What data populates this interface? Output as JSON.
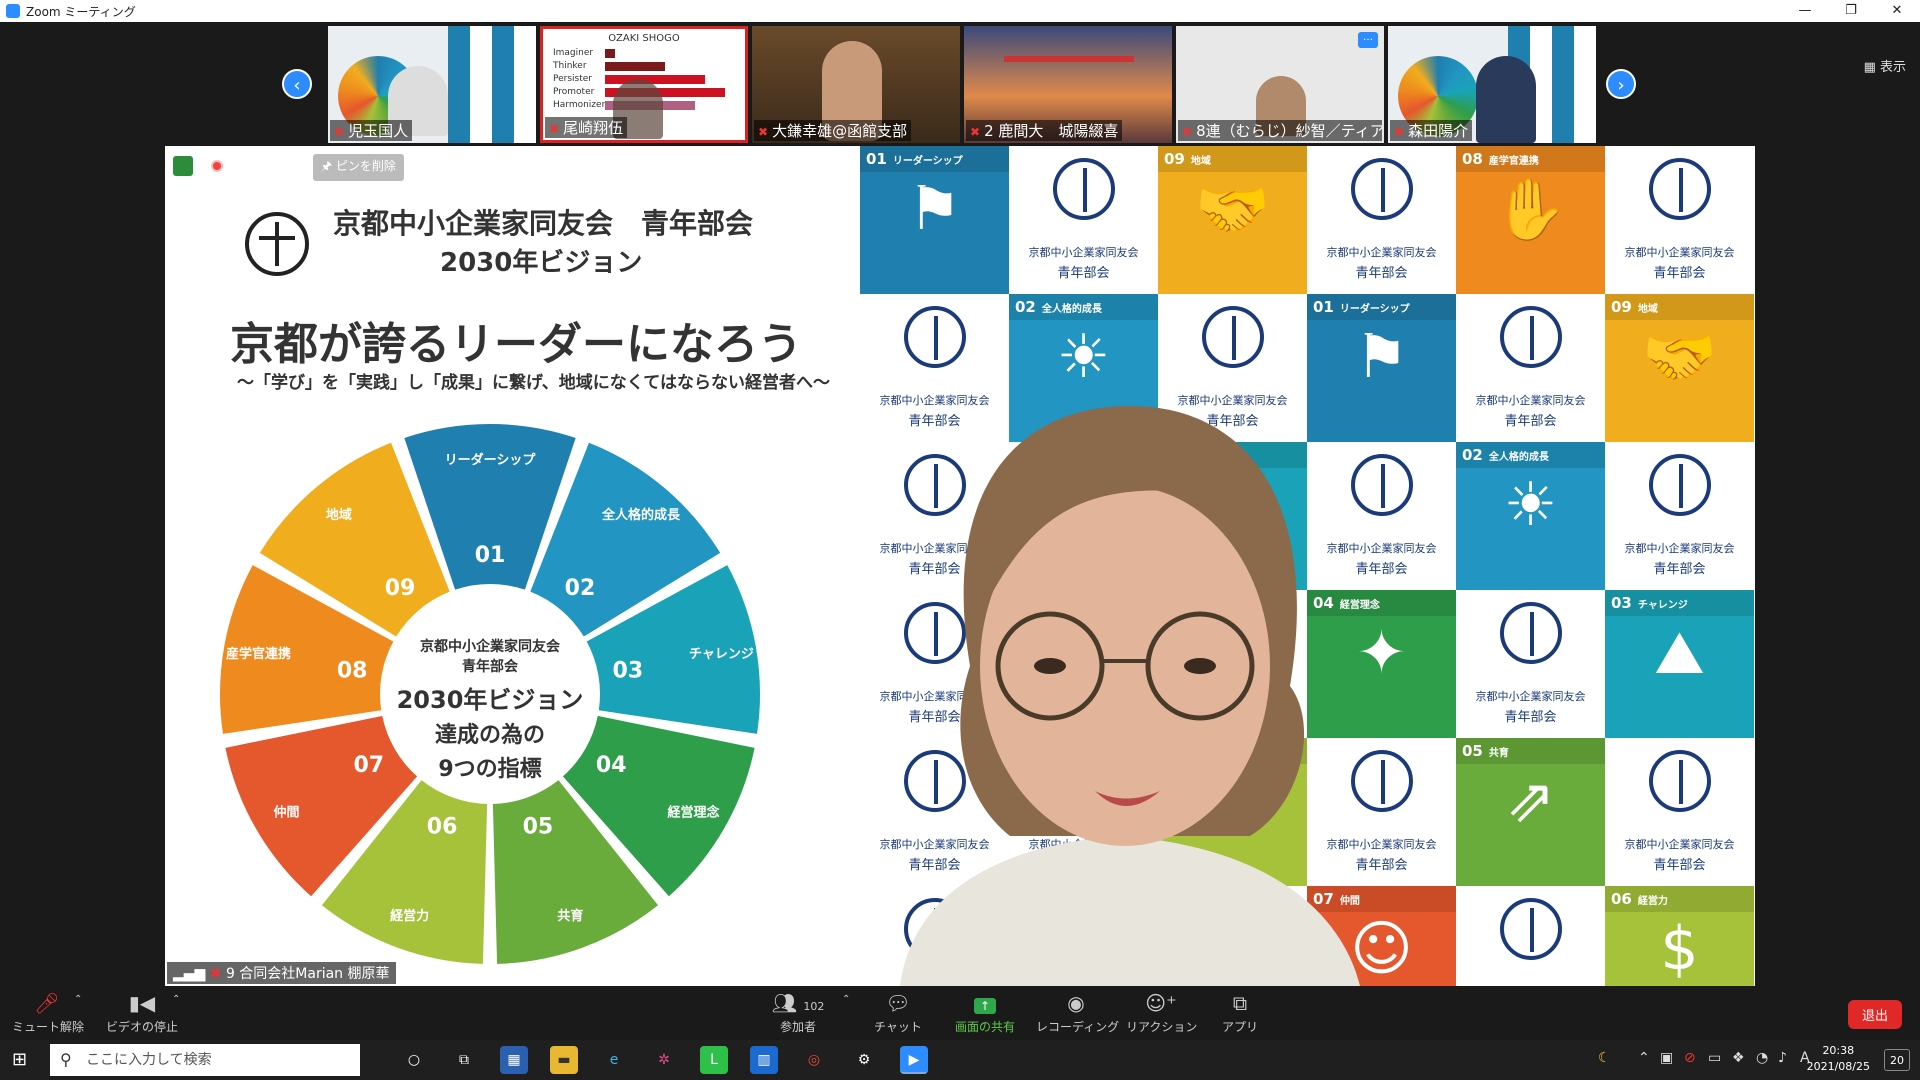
{
  "window": {
    "title": "Zoom ミーティング",
    "controls": [
      "—",
      "❐",
      "✕"
    ]
  },
  "gallery": {
    "prev_icon": "chevron-left-icon",
    "next_icon": "chevron-right-icon",
    "view_label": "▦ 表示",
    "participants": [
      {
        "name": "児玉国人",
        "muted": true
      },
      {
        "name": "尾崎翔伍",
        "muted": true,
        "overlay_title": "OZAKI SHOGO",
        "overlay_bars": [
          "Imaginer",
          "Thinker",
          "Persister",
          "Promoter",
          "Harmonizer"
        ]
      },
      {
        "name": "大鎌幸雄@函館支部",
        "muted": true
      },
      {
        "name": "2 鹿間大　城陽綴喜",
        "muted": true
      },
      {
        "name": "8連（むらじ）紗智／ティア…",
        "muted": true
      },
      {
        "name": "森田陽介",
        "muted": true
      }
    ]
  },
  "share": {
    "pin_label": "🖈 ピンを削除",
    "org_name": "京都中小企業家同友会　青年部会",
    "vision_title": "2030年ビジョン",
    "slogan": "京都が誇るリーダーになろう",
    "sub_slogan": "〜「学び」を「実践」し「成果」に繋げ、地域になくてはならない経営者へ〜",
    "wheel_center": {
      "line1": "京都中小企業家同友会",
      "line1b": "青年部会",
      "line2": "2030年ビジョン",
      "line3": "達成の為の",
      "line4": "9つの指標"
    },
    "wheel_segments": [
      {
        "num": "01",
        "label": "リーダーシップ",
        "color": "#1f7fae"
      },
      {
        "num": "02",
        "label": "全人格的成長",
        "color": "#2295c2"
      },
      {
        "num": "03",
        "label": "チャレンジ",
        "color": "#1aa3b8"
      },
      {
        "num": "04",
        "label": "経営理念",
        "color": "#2e9e4a"
      },
      {
        "num": "05",
        "label": "共育",
        "color": "#6aac3c"
      },
      {
        "num": "06",
        "label": "経営力",
        "color": "#a5c23a"
      },
      {
        "num": "07",
        "label": "仲間",
        "color": "#e5572c"
      },
      {
        "num": "08",
        "label": "産学官連携",
        "color": "#ee8a1e"
      },
      {
        "num": "09",
        "label": "地域",
        "color": "#f0ad1e"
      }
    ],
    "logo_text1": "京都中小企業家同友会",
    "logo_text2": "青年部会",
    "presenter_label": "9 合同会社Marian 棚原華"
  },
  "grid": [
    {
      "type": "tile",
      "num": "01",
      "label": "リーダーシップ",
      "color": "#1f7fae",
      "glyph": "⚑"
    },
    {
      "type": "logo"
    },
    {
      "type": "tile",
      "num": "09",
      "label": "地域",
      "color": "#f0ad1e",
      "glyph": "🤝"
    },
    {
      "type": "logo"
    },
    {
      "type": "tile",
      "num": "08",
      "label": "産学官連携",
      "color": "#ee8a1e",
      "glyph": "✋"
    },
    {
      "type": "logo"
    },
    {
      "type": "logo"
    },
    {
      "type": "tile",
      "num": "02",
      "label": "全人格的成長",
      "color": "#2295c2",
      "glyph": "☀"
    },
    {
      "type": "logo"
    },
    {
      "type": "tile",
      "num": "01",
      "label": "リーダーシップ",
      "color": "#1f7fae",
      "glyph": "⚑"
    },
    {
      "type": "logo"
    },
    {
      "type": "tile",
      "num": "09",
      "label": "地域",
      "color": "#f0ad1e",
      "glyph": "🤝"
    },
    {
      "type": "logo"
    },
    {
      "type": "logo"
    },
    {
      "type": "tile",
      "num": "03",
      "label": "チャレンジ",
      "color": "#1aa3b8",
      "glyph": "⛰"
    },
    {
      "type": "logo"
    },
    {
      "type": "tile",
      "num": "02",
      "label": "全人格的成長",
      "color": "#2295c2",
      "glyph": "☀"
    },
    {
      "type": "logo"
    },
    {
      "type": "logo"
    },
    {
      "type": "logo"
    },
    {
      "type": "logo"
    },
    {
      "type": "tile",
      "num": "04",
      "label": "経営理念",
      "color": "#2e9e4a",
      "glyph": "✦"
    },
    {
      "type": "logo"
    },
    {
      "type": "tile",
      "num": "03",
      "label": "チャレンジ",
      "color": "#1aa3b8",
      "glyph": "⛰"
    },
    {
      "type": "logo"
    },
    {
      "type": "logo"
    },
    {
      "type": "tile",
      "num": "06",
      "label": "経営力",
      "color": "#a5c23a",
      "glyph": "$"
    },
    {
      "type": "logo"
    },
    {
      "type": "tile",
      "num": "05",
      "label": "共育",
      "color": "#6aac3c",
      "glyph": "⇗"
    },
    {
      "type": "logo"
    },
    {
      "type": "logo"
    },
    {
      "type": "logo"
    },
    {
      "type": "logo"
    },
    {
      "type": "tile",
      "num": "07",
      "label": "仲間",
      "color": "#e5572c",
      "glyph": "☺"
    },
    {
      "type": "logo"
    },
    {
      "type": "tile",
      "num": "06",
      "label": "経営力",
      "color": "#a5c23a",
      "glyph": "$"
    }
  ],
  "toolbar": {
    "mute": "ミュート解除",
    "video": "ビデオの停止",
    "participants": "参加者",
    "participant_count": "102",
    "chat": "チャット",
    "share": "画面の共有",
    "record": "レコーディング",
    "reaction": "リアクション",
    "apps": "アプリ",
    "leave": "退出"
  },
  "taskbar": {
    "search_placeholder": "ここに入力して検索",
    "time": "20:38",
    "date": "2021/08/25",
    "notifications": "20",
    "ime": "A"
  }
}
